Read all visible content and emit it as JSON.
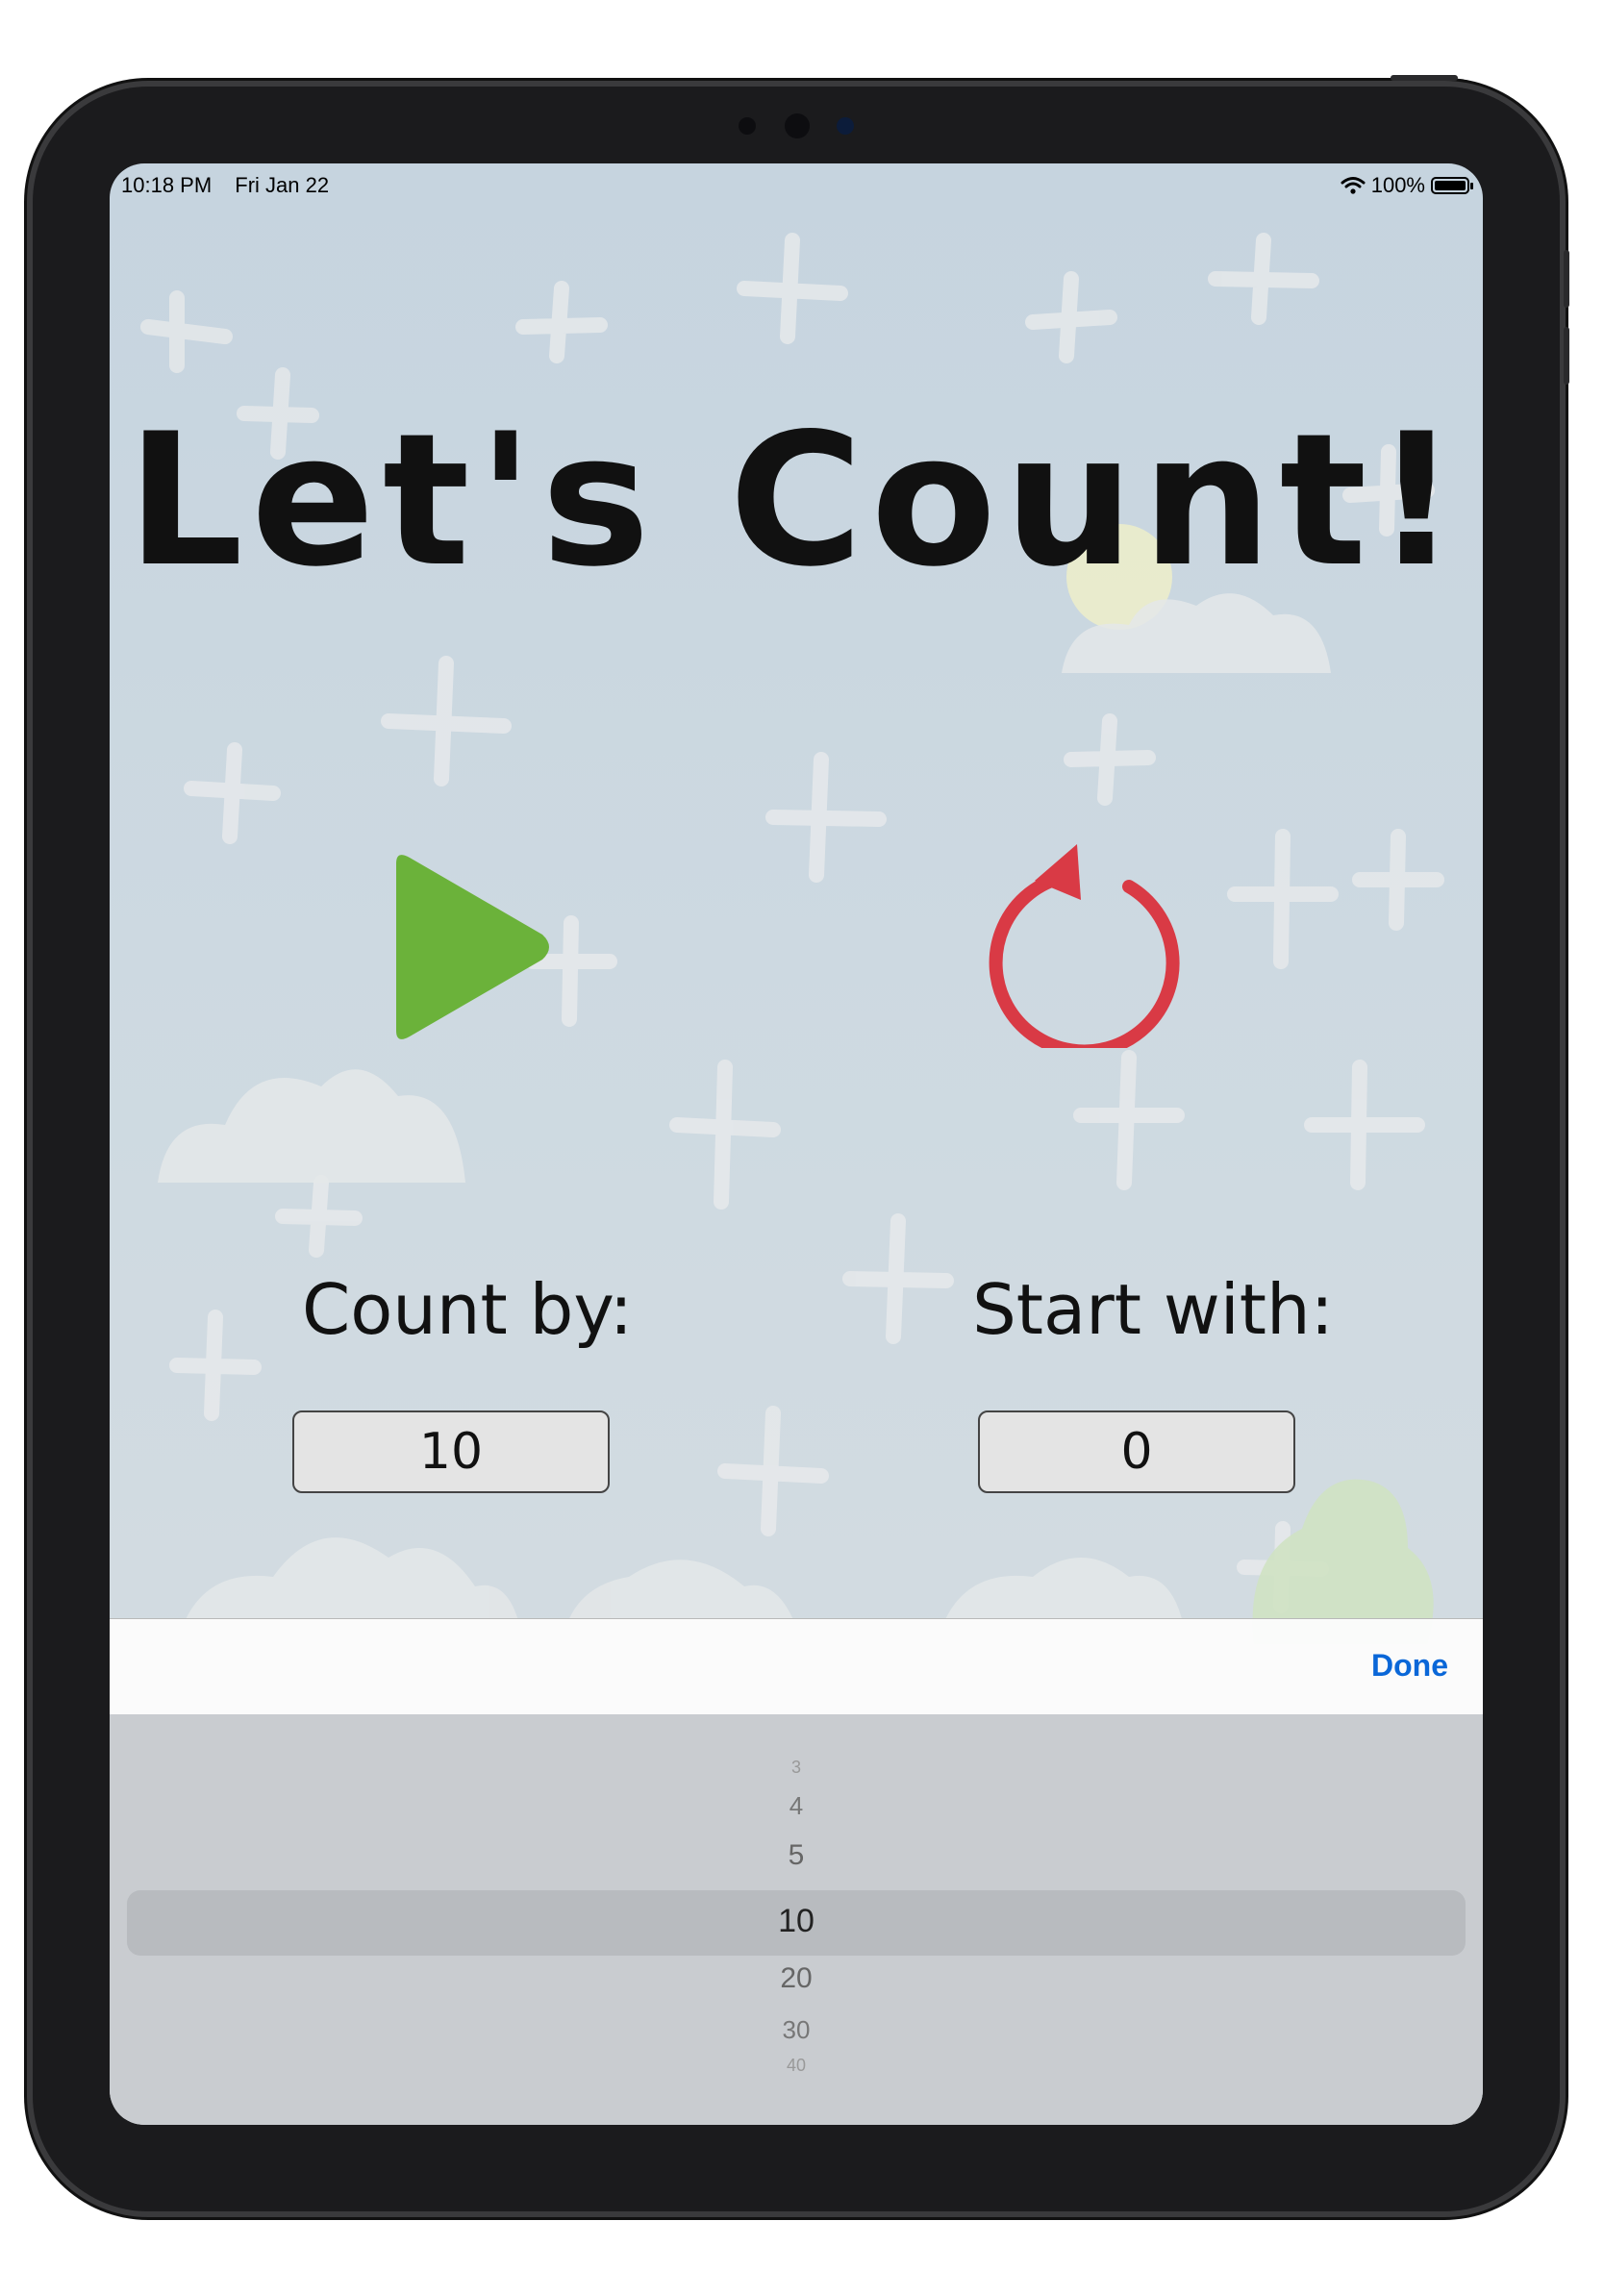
{
  "status_bar": {
    "time": "10:18 PM",
    "date": "Fri Jan 22",
    "battery": "100%"
  },
  "app": {
    "title": "Let's Count!",
    "play_icon": "play-icon",
    "reset_icon": "reset-icon",
    "colors": {
      "play": "#6bb23a",
      "reset": "#d93a45"
    }
  },
  "count_by": {
    "label": "Count by:",
    "value": "10"
  },
  "start_with": {
    "label": "Start with:",
    "value": "0"
  },
  "toolbar": {
    "done_label": "Done"
  },
  "picker": {
    "options": [
      "3",
      "4",
      "5",
      "10",
      "20",
      "30",
      "40"
    ],
    "selected": "10"
  }
}
